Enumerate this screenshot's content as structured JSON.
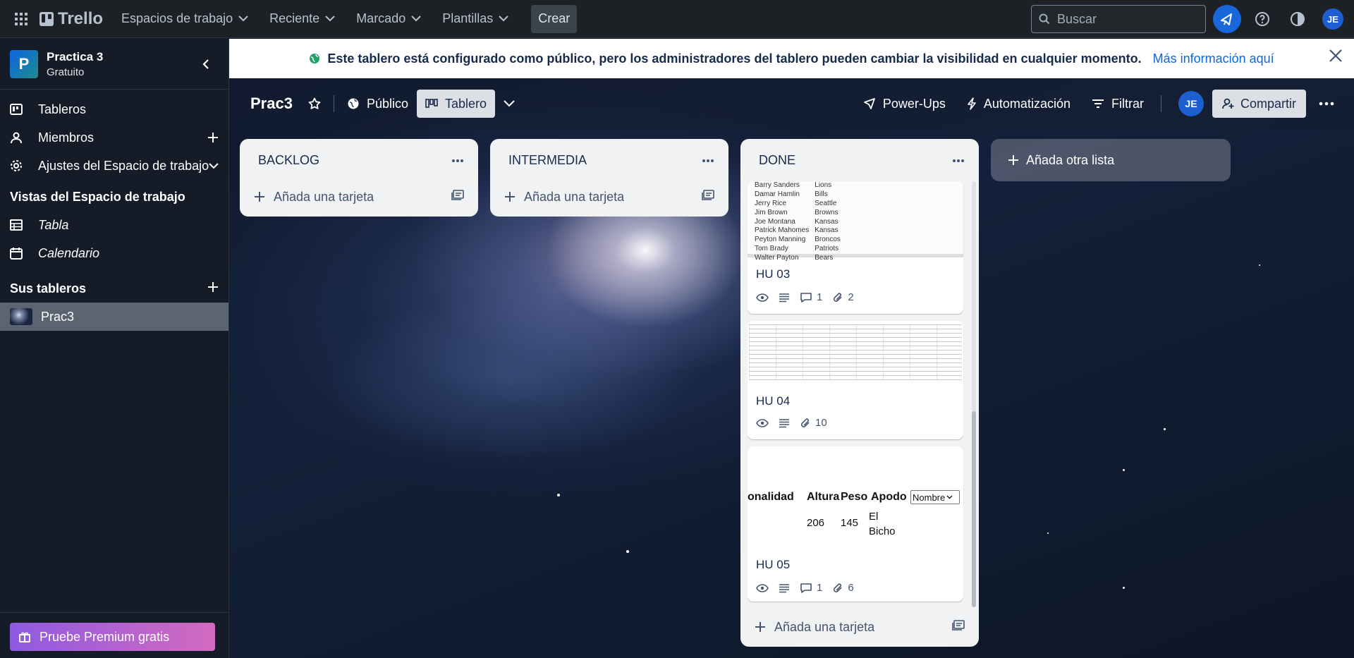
{
  "topbar": {
    "logo_text": "Trello",
    "nav": [
      {
        "label": "Espacios de trabajo"
      },
      {
        "label": "Reciente"
      },
      {
        "label": "Marcado"
      },
      {
        "label": "Plantillas"
      }
    ],
    "create_label": "Crear",
    "search_placeholder": "Buscar",
    "avatar_initials": "JE"
  },
  "sidebar": {
    "workspace_initial": "P",
    "workspace_name": "Practica 3",
    "workspace_plan": "Gratuito",
    "items": [
      {
        "label": "Tableros"
      },
      {
        "label": "Miembros"
      },
      {
        "label": "Ajustes del Espacio de trabajo"
      }
    ],
    "views_heading": "Vistas del Espacio de trabajo",
    "views": [
      {
        "label": "Tabla"
      },
      {
        "label": "Calendario"
      }
    ],
    "boards_heading": "Sus tableros",
    "boards": [
      {
        "label": "Prac3"
      }
    ],
    "premium_label": "Pruebe Premium gratis"
  },
  "banner": {
    "message": "Este tablero está configurado como público, pero los administradores del tablero pueden cambiar la visibilidad en cualquier momento.",
    "link": "Más información aquí"
  },
  "board_header": {
    "title": "Prac3",
    "visibility": "Público",
    "view": "Tablero",
    "powerups": "Power-Ups",
    "automation": "Automatización",
    "filter": "Filtrar",
    "avatar_initials": "JE",
    "share": "Compartir"
  },
  "lists": [
    {
      "title": "BACKLOG",
      "add_card": "Añada una tarjeta"
    },
    {
      "title": "INTERMEDIA",
      "add_card": "Añada una tarjeta"
    },
    {
      "title": "DONE",
      "add_card": "Añada una tarjeta"
    }
  ],
  "cards": [
    {
      "title": "HU 03",
      "comments": "1",
      "attachments": "2",
      "cover_rows": [
        [
          "Barry Sanders",
          "Lions"
        ],
        [
          "Damar Hamlin",
          "Bills"
        ],
        [
          "Jerry Rice",
          "Seattle"
        ],
        [
          "Jim Brown",
          "Browns"
        ],
        [
          "Joe Montana",
          "Kansas"
        ],
        [
          "Patrick Mahomes",
          "Kansas"
        ],
        [
          "Peyton Manning",
          "Broncos"
        ],
        [
          "Tom Brady",
          "Patriots"
        ],
        [
          "Walter Payton",
          "Bears"
        ]
      ]
    },
    {
      "title": "HU 04",
      "attachments": "10"
    },
    {
      "title": "HU 05",
      "comments": "1",
      "attachments": "6",
      "cover": {
        "h1": "onalidad",
        "h2": "Altura",
        "h3": "Peso",
        "h4": "Apodo",
        "select": "Nombre",
        "v1": "206",
        "v2": "145",
        "v3a": "El",
        "v3b": "Bicho"
      }
    }
  ],
  "add_list_label": "Añada otra lista",
  "colors": {
    "topbar": "#1d2125",
    "sidebar": "#161b28",
    "accent": "#0c66e4",
    "premium_start": "#8f5ae0",
    "premium_end": "#d36ac0",
    "list_bg": "#f1f2f4"
  }
}
